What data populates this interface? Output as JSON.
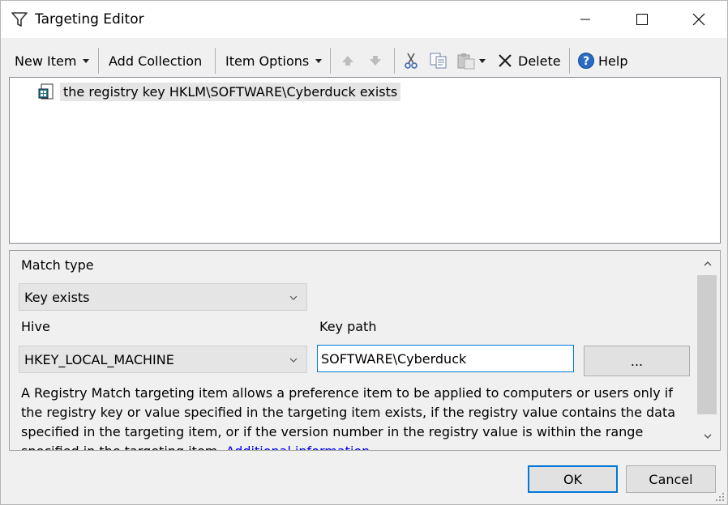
{
  "window": {
    "title": "Targeting Editor"
  },
  "toolbar": {
    "new_item": "New Item",
    "add_collection": "Add Collection",
    "item_options": "Item Options",
    "delete": "Delete",
    "help": "Help"
  },
  "tree": {
    "items": [
      {
        "label": "the registry key HKLM\\SOFTWARE\\Cyberduck exists"
      }
    ]
  },
  "properties": {
    "match_type_label": "Match type",
    "match_type_value": "Key exists",
    "hive_label": "Hive",
    "hive_value": "HKEY_LOCAL_MACHINE",
    "key_path_label": "Key path",
    "key_path_value": "SOFTWARE\\Cyberduck",
    "browse_label": "...",
    "description": "A Registry Match targeting item allows a preference item to be applied to computers or users only if the registry key or value specified in the targeting item exists, if the registry value contains the data specified in the targeting item, or if the version number in the registry value is within the range specified in the targeting item. ",
    "more_info_link": "Additional information..."
  },
  "footer": {
    "ok": "OK",
    "cancel": "Cancel"
  },
  "colors": {
    "accent": "#0078d7",
    "link": "#0000ee",
    "selection": "#e5e5e5"
  }
}
